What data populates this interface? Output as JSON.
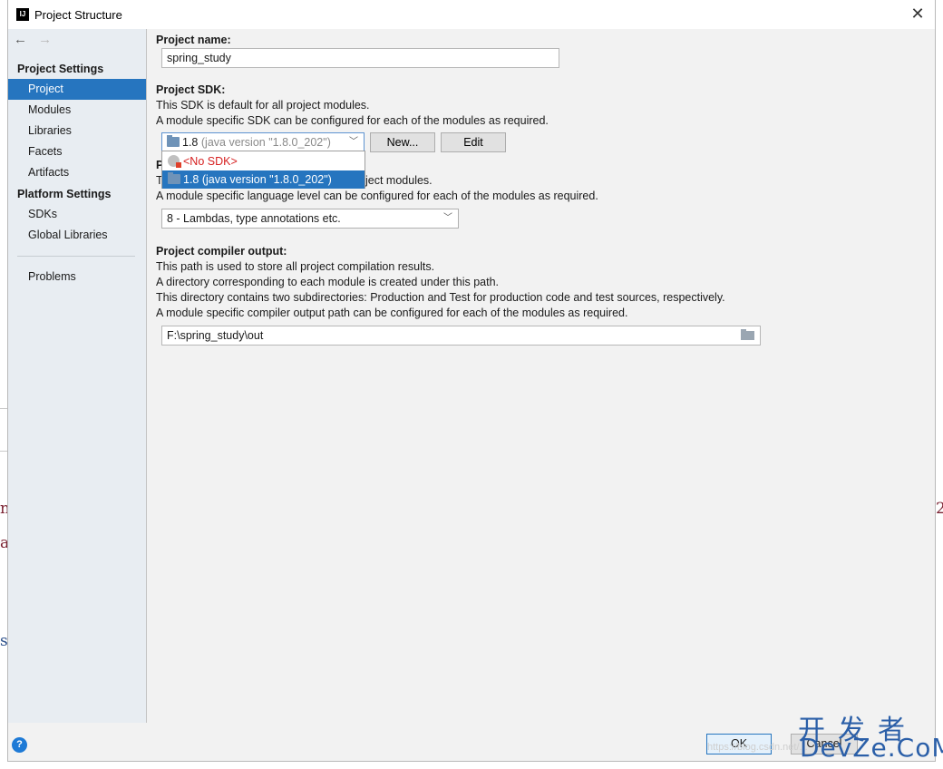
{
  "window": {
    "title": "Project Structure",
    "app_logo": "IJ"
  },
  "sidebar": {
    "project_settings_header": "Project Settings",
    "items": {
      "project": "Project",
      "modules": "Modules",
      "libraries": "Libraries",
      "facets": "Facets",
      "artifacts": "Artifacts"
    },
    "platform_settings_header": "Platform Settings",
    "platform_items": {
      "sdks": "SDKs",
      "global_libraries": "Global Libraries"
    },
    "problems": "Problems"
  },
  "project": {
    "name_label": "Project name:",
    "name_value": "spring_study",
    "sdk_label": "Project SDK:",
    "sdk_desc1": "This SDK is default for all project modules.",
    "sdk_desc2": "A module specific SDK can be configured for each of the modules as required.",
    "sdk_selected_version": "1.8",
    "sdk_selected_detail": "(java version \"1.8.0_202\")",
    "new_button": "New...",
    "edit_button": "Edit",
    "dropdown_no_sdk": "<No SDK>",
    "dropdown_option_1": "1.8 (java version \"1.8.0_202\")",
    "lang_label_partial": "P",
    "lang_desc1_start": "T",
    "lang_desc1_end": "ject modules.",
    "lang_desc2": "A module specific language level can be configured for each of the modules as required.",
    "lang_level_value": "8 - Lambdas, type annotations etc.",
    "output_label": "Project compiler output:",
    "output_desc1": "This path is used to store all project compilation results.",
    "output_desc2": "A directory corresponding to each module is created under this path.",
    "output_desc3": "This directory contains two subdirectories: Production and Test for production code and test sources, respectively.",
    "output_desc4": "A module specific compiler output path can be configured for each of the modules as required.",
    "output_path": "F:\\spring_study\\out"
  },
  "footer": {
    "help": "?",
    "ok": "OK",
    "cancel": "Cancel"
  },
  "watermark": {
    "url": "https://blog.csdn.net/...",
    "cn": "开发者",
    "en": "DevZe.CoM"
  },
  "background_fragments": {
    "a": "n",
    "b": "a",
    "c": "s",
    "d": "2"
  },
  "colors": {
    "selection": "#2675bf",
    "sidebar_bg": "#e8edf2",
    "no_sdk_red": "#d62020"
  }
}
